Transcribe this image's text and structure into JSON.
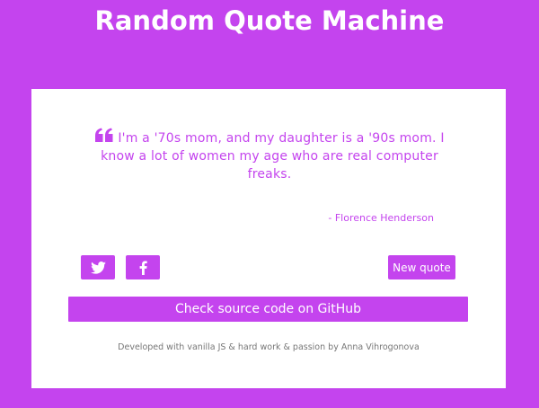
{
  "header": {
    "title": "Random Quote Machine"
  },
  "quote": {
    "icon": "quote-left-icon",
    "text": "I'm a '70s mom, and my daughter is a '90s mom. I know a lot of women my age who are real computer freaks.",
    "author": "- Florence Henderson"
  },
  "actions": {
    "twitter_icon": "twitter-icon",
    "facebook_icon": "facebook-icon",
    "new_quote_label": "New quote",
    "github_label": "Check source code on GitHub"
  },
  "footer": {
    "text": "Developed with vanilla JS & hard work & passion by Anna Vihrogonova"
  },
  "colors": {
    "background": "#c444ee",
    "card": "#ffffff",
    "accent": "#c444ee",
    "footer_text": "#777777"
  }
}
